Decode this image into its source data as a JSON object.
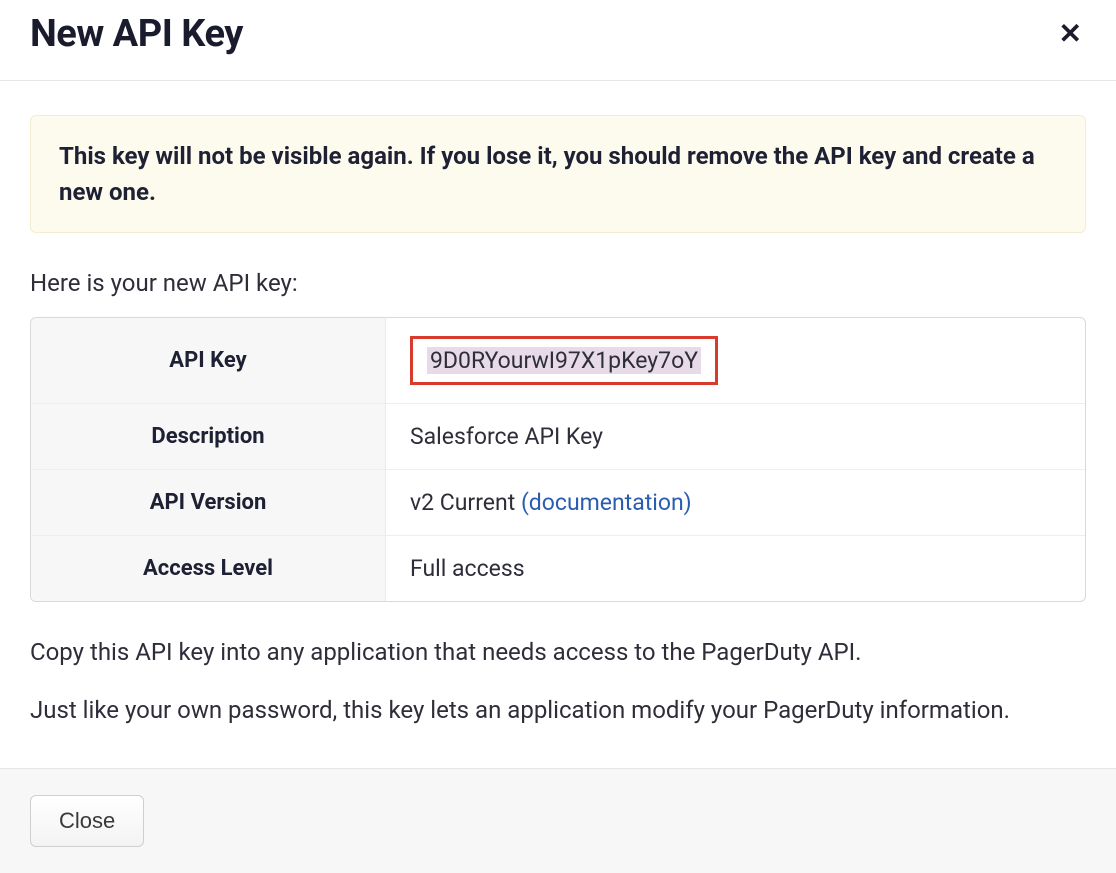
{
  "modal": {
    "title": "New API Key",
    "warning": "This key will not be visible again. If you lose it, you should remove the API key and create a new one.",
    "intro": "Here is your new API key:",
    "table": {
      "rows": {
        "api_key": {
          "label": "API Key",
          "value": "9D0RYourwI97X1pKey7oY"
        },
        "description": {
          "label": "Description",
          "value": "Salesforce API Key"
        },
        "api_version": {
          "label": "API Version",
          "value_prefix": "v2 Current ",
          "link_text": "(documentation)"
        },
        "access_level": {
          "label": "Access Level",
          "value": "Full access"
        }
      }
    },
    "copy_text": "Copy this API key into any application that needs access to the PagerDuty API.",
    "password_text": "Just like your own password, this key lets an application modify your PagerDuty information.",
    "close_button": "Close"
  }
}
